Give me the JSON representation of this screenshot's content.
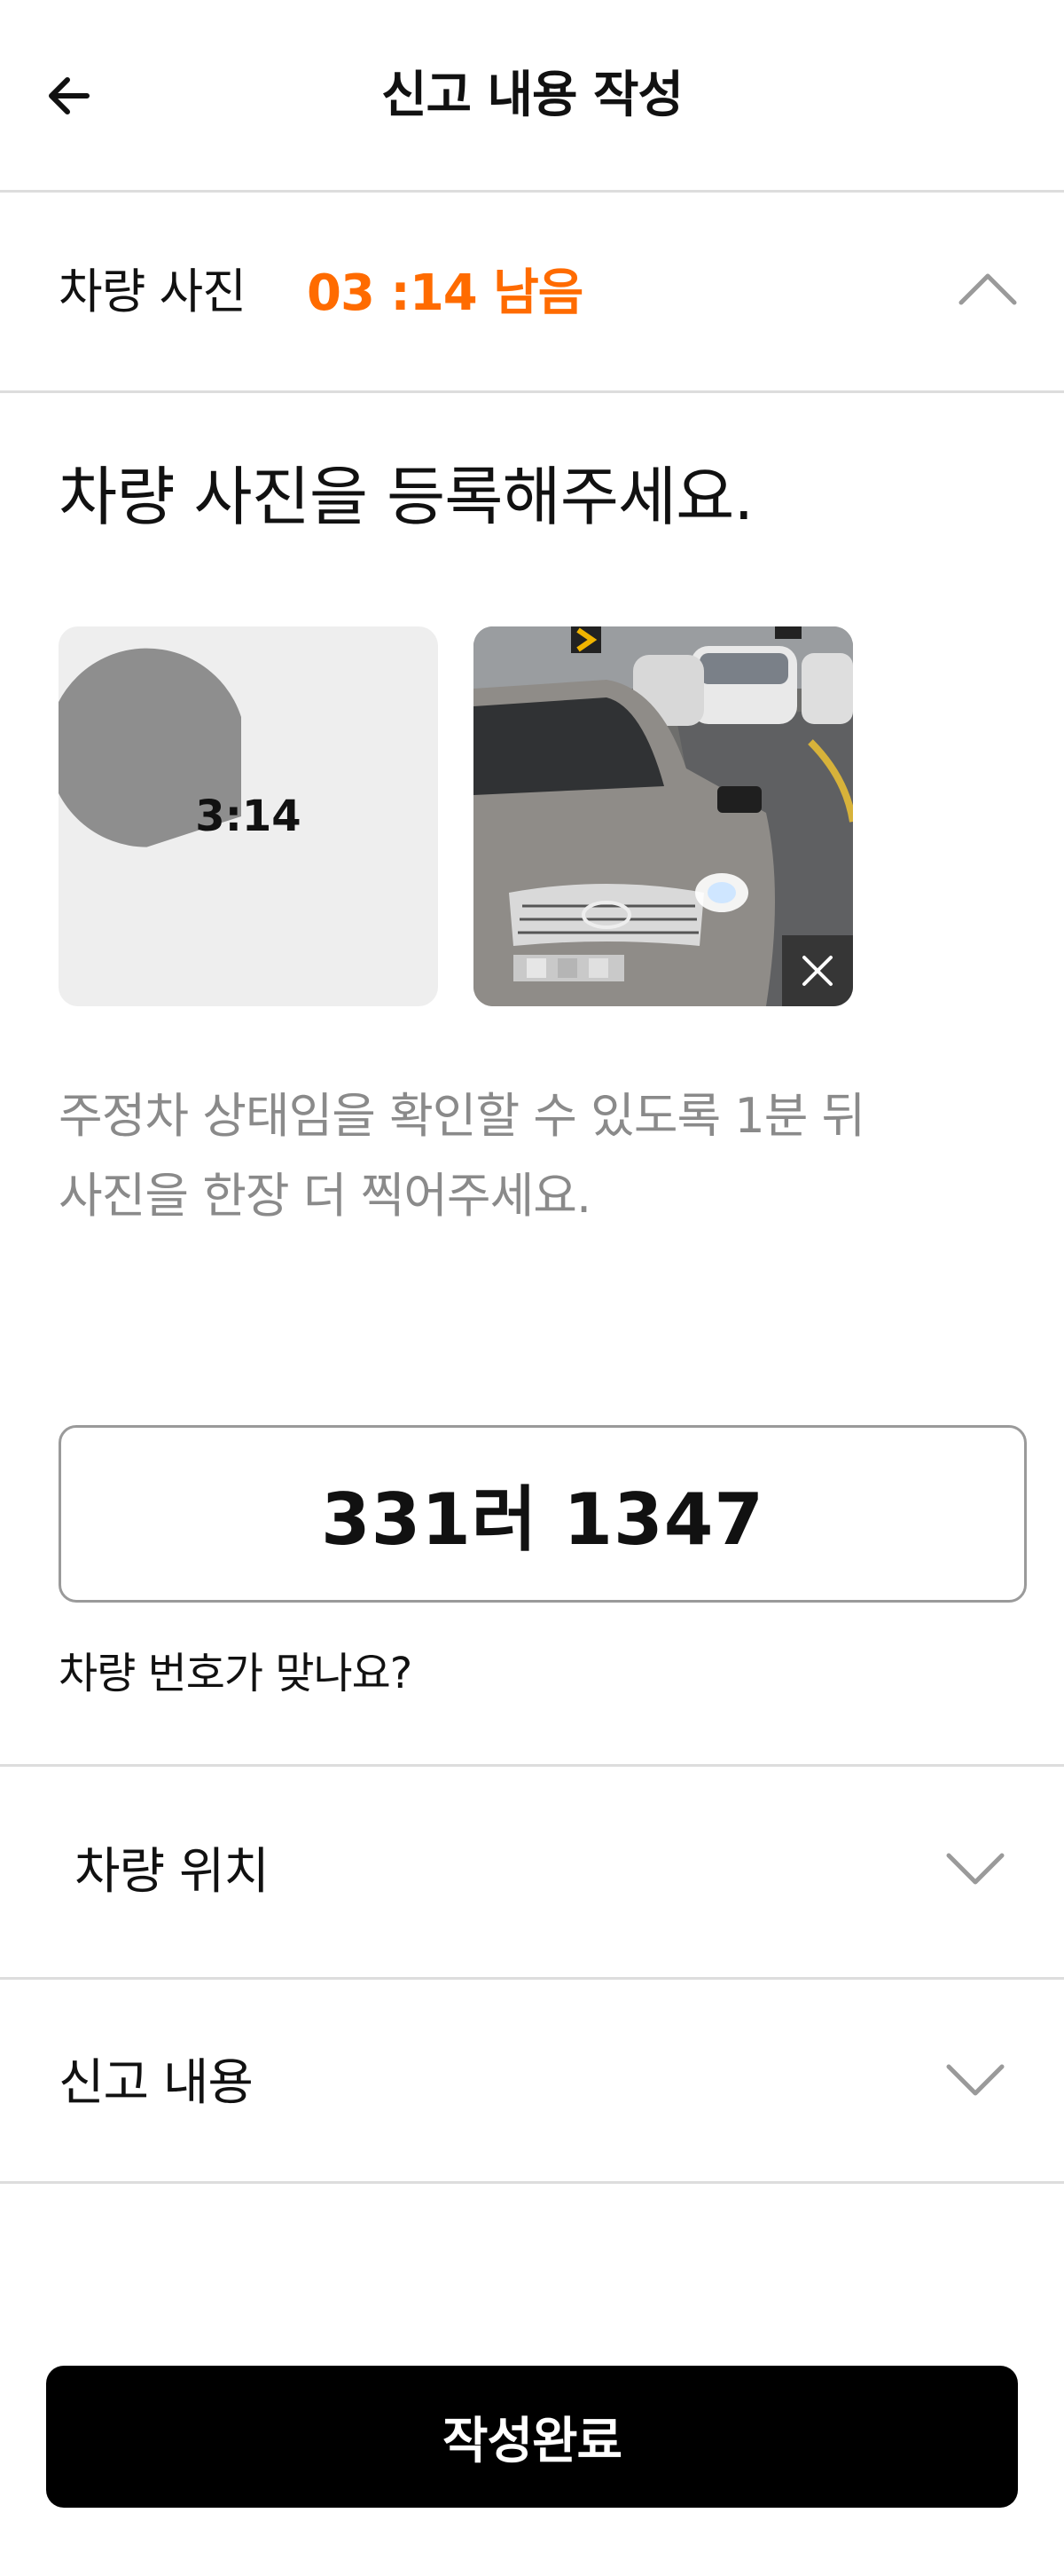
{
  "header": {
    "title": "신고 내용 작성",
    "back_icon": "arrow-left-icon"
  },
  "photo_section": {
    "label": "차량 사진",
    "timer_text": "03 :14 남음",
    "timer_color": "#FF6B00",
    "expanded": true,
    "headline": "차량 사진을 등록해주세요.",
    "timer_thumb": {
      "label": "3:14",
      "remaining_fraction": 0.7
    },
    "guide_lines": [
      "주정차 상태임을 확인할 수 있도록 1분 뒤",
      "사진을 한장 더 찍어주세요."
    ]
  },
  "plate": {
    "number": "331러 1347",
    "question": "차량 번호가 맞나요?"
  },
  "location_section": {
    "label": "차량 위치",
    "expanded": false
  },
  "report_section": {
    "label": "신고 내용",
    "expanded": false
  },
  "submit": {
    "label": "작성완료",
    "color": "#000000"
  }
}
